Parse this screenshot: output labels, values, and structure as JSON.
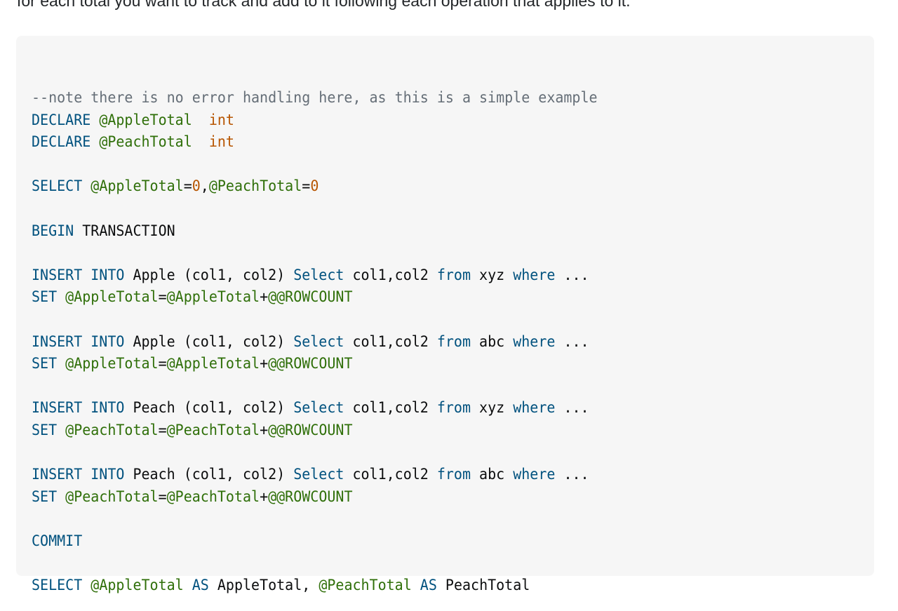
{
  "intro_text": "for each total you want to track and add to it following each operation that applies to it.",
  "code": {
    "language": "sql",
    "lines": [
      [
        {
          "t": "cmt",
          "v": "--note there is no error handling here, as this is a simple example"
        }
      ],
      [
        {
          "t": "kw",
          "v": "DECLARE"
        },
        {
          "t": "id",
          "v": " "
        },
        {
          "t": "var",
          "v": "@AppleTotal"
        },
        {
          "t": "id",
          "v": "  "
        },
        {
          "t": "num",
          "v": "int"
        }
      ],
      [
        {
          "t": "kw",
          "v": "DECLARE"
        },
        {
          "t": "id",
          "v": " "
        },
        {
          "t": "var",
          "v": "@PeachTotal"
        },
        {
          "t": "id",
          "v": "  "
        },
        {
          "t": "num",
          "v": "int"
        }
      ],
      [],
      [
        {
          "t": "kw",
          "v": "SELECT"
        },
        {
          "t": "id",
          "v": " "
        },
        {
          "t": "var",
          "v": "@AppleTotal"
        },
        {
          "t": "id",
          "v": "="
        },
        {
          "t": "num",
          "v": "0"
        },
        {
          "t": "id",
          "v": ","
        },
        {
          "t": "var",
          "v": "@PeachTotal"
        },
        {
          "t": "id",
          "v": "="
        },
        {
          "t": "num",
          "v": "0"
        }
      ],
      [],
      [
        {
          "t": "kw",
          "v": "BEGIN"
        },
        {
          "t": "id",
          "v": " TRANSACTION"
        }
      ],
      [],
      [
        {
          "t": "kw",
          "v": "INSERT INTO"
        },
        {
          "t": "id",
          "v": " Apple (col1, col2) "
        },
        {
          "t": "kw",
          "v": "Select"
        },
        {
          "t": "id",
          "v": " col1,col2 "
        },
        {
          "t": "kw",
          "v": "from"
        },
        {
          "t": "id",
          "v": " xyz "
        },
        {
          "t": "kw",
          "v": "where"
        },
        {
          "t": "id",
          "v": " ..."
        }
      ],
      [
        {
          "t": "kw",
          "v": "SET"
        },
        {
          "t": "id",
          "v": " "
        },
        {
          "t": "var",
          "v": "@AppleTotal"
        },
        {
          "t": "id",
          "v": "="
        },
        {
          "t": "var",
          "v": "@AppleTotal"
        },
        {
          "t": "id",
          "v": "+"
        },
        {
          "t": "var",
          "v": "@@ROWCOUNT"
        }
      ],
      [],
      [
        {
          "t": "kw",
          "v": "INSERT INTO"
        },
        {
          "t": "id",
          "v": " Apple (col1, col2) "
        },
        {
          "t": "kw",
          "v": "Select"
        },
        {
          "t": "id",
          "v": " col1,col2 "
        },
        {
          "t": "kw",
          "v": "from"
        },
        {
          "t": "id",
          "v": " abc "
        },
        {
          "t": "kw",
          "v": "where"
        },
        {
          "t": "id",
          "v": " ..."
        }
      ],
      [
        {
          "t": "kw",
          "v": "SET"
        },
        {
          "t": "id",
          "v": " "
        },
        {
          "t": "var",
          "v": "@AppleTotal"
        },
        {
          "t": "id",
          "v": "="
        },
        {
          "t": "var",
          "v": "@AppleTotal"
        },
        {
          "t": "id",
          "v": "+"
        },
        {
          "t": "var",
          "v": "@@ROWCOUNT"
        }
      ],
      [],
      [
        {
          "t": "kw",
          "v": "INSERT INTO"
        },
        {
          "t": "id",
          "v": " Peach (col1, col2) "
        },
        {
          "t": "kw",
          "v": "Select"
        },
        {
          "t": "id",
          "v": " col1,col2 "
        },
        {
          "t": "kw",
          "v": "from"
        },
        {
          "t": "id",
          "v": " xyz "
        },
        {
          "t": "kw",
          "v": "where"
        },
        {
          "t": "id",
          "v": " ..."
        }
      ],
      [
        {
          "t": "kw",
          "v": "SET"
        },
        {
          "t": "id",
          "v": " "
        },
        {
          "t": "var",
          "v": "@PeachTotal"
        },
        {
          "t": "id",
          "v": "="
        },
        {
          "t": "var",
          "v": "@PeachTotal"
        },
        {
          "t": "id",
          "v": "+"
        },
        {
          "t": "var",
          "v": "@@ROWCOUNT"
        }
      ],
      [],
      [
        {
          "t": "kw",
          "v": "INSERT INTO"
        },
        {
          "t": "id",
          "v": " Peach (col1, col2) "
        },
        {
          "t": "kw",
          "v": "Select"
        },
        {
          "t": "id",
          "v": " col1,col2 "
        },
        {
          "t": "kw",
          "v": "from"
        },
        {
          "t": "id",
          "v": " abc "
        },
        {
          "t": "kw",
          "v": "where"
        },
        {
          "t": "id",
          "v": " ..."
        }
      ],
      [
        {
          "t": "kw",
          "v": "SET"
        },
        {
          "t": "id",
          "v": " "
        },
        {
          "t": "var",
          "v": "@PeachTotal"
        },
        {
          "t": "id",
          "v": "="
        },
        {
          "t": "var",
          "v": "@PeachTotal"
        },
        {
          "t": "id",
          "v": "+"
        },
        {
          "t": "var",
          "v": "@@ROWCOUNT"
        }
      ],
      [],
      [
        {
          "t": "kw",
          "v": "COMMIT"
        }
      ],
      [],
      [
        {
          "t": "kw",
          "v": "SELECT"
        },
        {
          "t": "id",
          "v": " "
        },
        {
          "t": "var",
          "v": "@AppleTotal"
        },
        {
          "t": "id",
          "v": " "
        },
        {
          "t": "kw",
          "v": "AS"
        },
        {
          "t": "id",
          "v": " AppleTotal, "
        },
        {
          "t": "var",
          "v": "@PeachTotal"
        },
        {
          "t": "id",
          "v": " "
        },
        {
          "t": "kw",
          "v": "AS"
        },
        {
          "t": "id",
          "v": " PeachTotal"
        }
      ]
    ]
  },
  "colors": {
    "keyword": "#00517e",
    "variable": "#2f6f09",
    "literal": "#b75501",
    "comment": "#656e77",
    "text": "#0c0d0e",
    "code_background": "#f6f6f6"
  }
}
